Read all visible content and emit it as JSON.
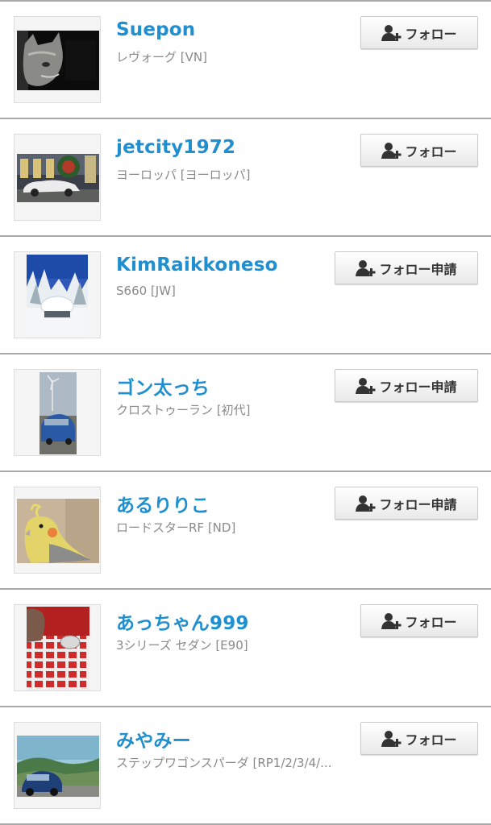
{
  "users": [
    {
      "name": "Suepon",
      "car": "レヴォーグ [VN]",
      "button": "フォロー",
      "button_type": "follow",
      "thumb": "cat-photo"
    },
    {
      "name": "jetcity1972",
      "car": "ヨーロッパ [ヨーロッパ]",
      "button": "フォロー",
      "button_type": "follow",
      "thumb": "classic-car-photo"
    },
    {
      "name": "KimRaikkoneso",
      "car": "S660 [JW]",
      "button": "フォロー申請",
      "button_type": "request",
      "thumb": "snow-car-photo"
    },
    {
      "name": "ゴン太っち",
      "car": "クロストゥーラン [初代]",
      "button": "フォロー申請",
      "button_type": "request",
      "thumb": "blue-car-windmill-photo"
    },
    {
      "name": "あるりりこ",
      "car": "ロードスターRF [ND]",
      "button": "フォロー申請",
      "button_type": "request",
      "thumb": "cockatiel-photo"
    },
    {
      "name": "あっちゃん999",
      "car": "3シリーズ セダン [E90]",
      "button": "フォロー",
      "button_type": "follow",
      "thumb": "cat-tablecloth-photo"
    },
    {
      "name": "みやみー",
      "car": "ステップワゴンスパーダ [RP1/2/3/4/...",
      "button": "フォロー",
      "button_type": "follow",
      "thumb": "blue-car-hills-photo"
    }
  ],
  "colors": {
    "username": "#1f8fd0",
    "subtext": "#8a8a8a",
    "divider": "#a9a9a9"
  },
  "icons": {
    "follow_button_icon": "add-user-icon"
  }
}
